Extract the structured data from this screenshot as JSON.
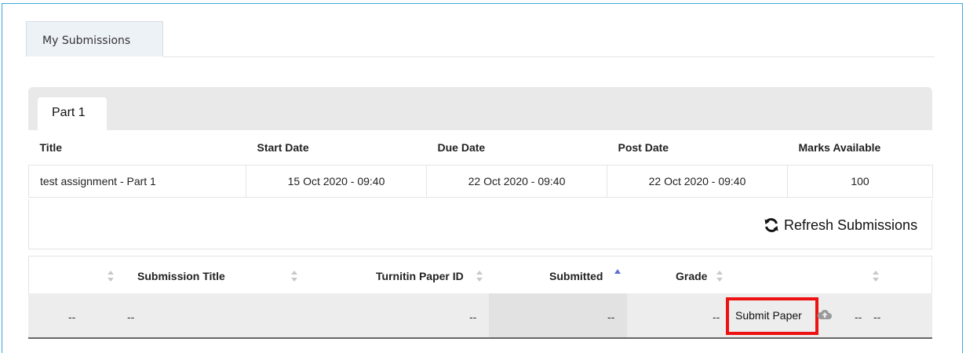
{
  "main_tab": {
    "label": "My Submissions"
  },
  "part_tab": {
    "label": "Part 1"
  },
  "assignment_table": {
    "headers": [
      "Title",
      "Start Date",
      "Due Date",
      "Post Date",
      "Marks Available"
    ],
    "row": [
      "test assignment - Part 1",
      "15 Oct 2020 - 09:40",
      "22 Oct 2020 - 09:40",
      "22 Oct 2020 - 09:40",
      "100"
    ]
  },
  "refresh": {
    "label": "Refresh Submissions",
    "icon": "refresh-icon"
  },
  "submissions_table": {
    "headers": {
      "submission_title": "Submission Title",
      "turnitin_paper_id": "Turnitin Paper ID",
      "submitted": "Submitted",
      "grade": "Grade"
    },
    "sorted_column": "submitted",
    "sort_direction": "ascending",
    "row": {
      "col1": "--",
      "title": "--",
      "paper_id": "--",
      "submitted": "--",
      "grade": "--",
      "submit_label": "Submit Paper",
      "submit_icon": "cloud-upload-icon",
      "extra1": "--",
      "extra2": "--"
    }
  },
  "colors": {
    "frame_border": "#3aa8d8",
    "highlight": "#ee1111",
    "sort_active": "#5b6fd6"
  }
}
